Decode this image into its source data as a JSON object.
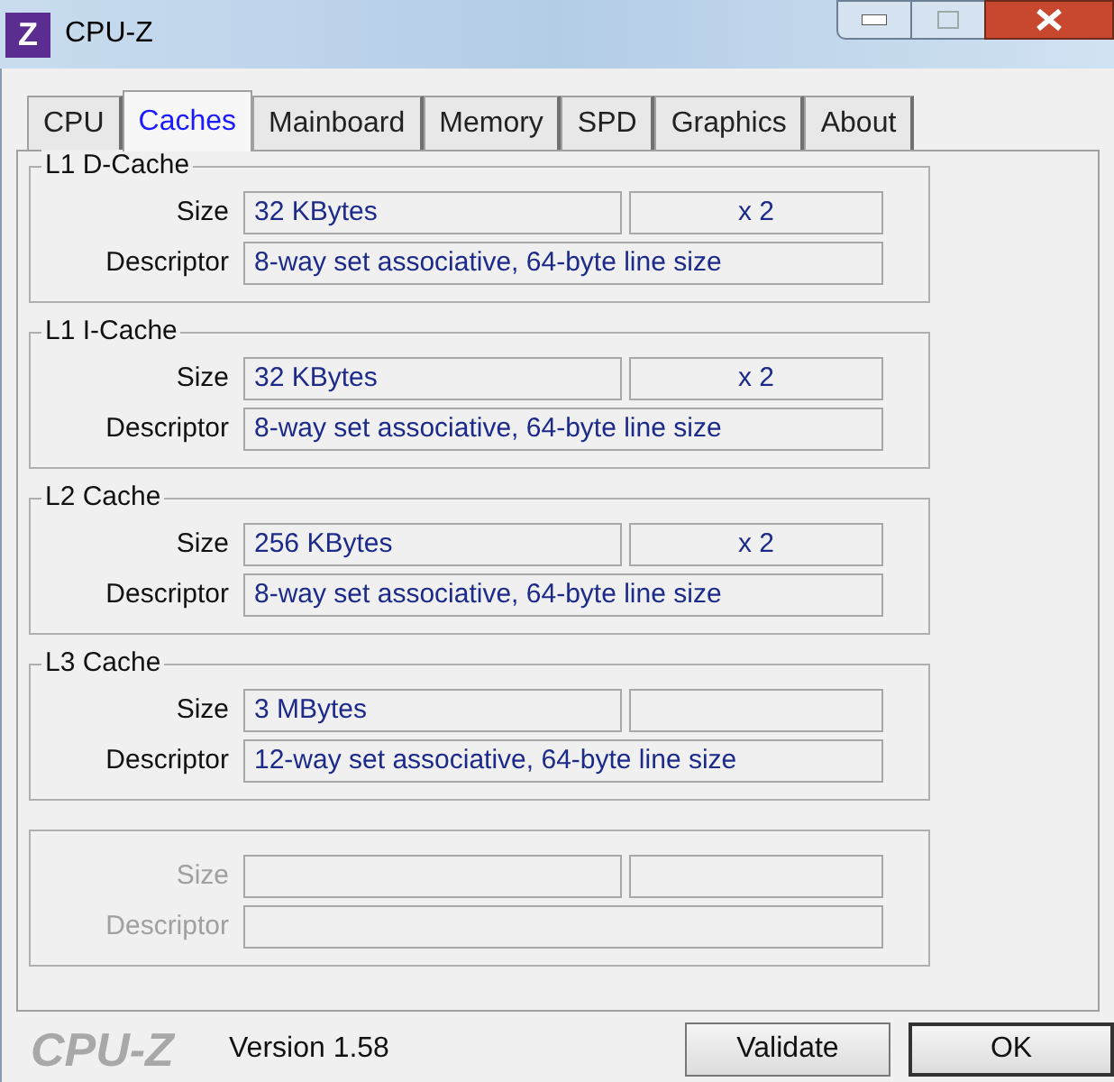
{
  "window": {
    "app_icon": "Z",
    "title": "CPU-Z"
  },
  "tabs": [
    {
      "label": "CPU",
      "selected": false
    },
    {
      "label": "Caches",
      "selected": true
    },
    {
      "label": "Mainboard",
      "selected": false
    },
    {
      "label": "Memory",
      "selected": false
    },
    {
      "label": "SPD",
      "selected": false
    },
    {
      "label": "Graphics",
      "selected": false
    },
    {
      "label": "About",
      "selected": false
    }
  ],
  "groups": [
    {
      "title": "L1 D-Cache",
      "disabled": false,
      "size_label": "Size",
      "size": "32 KBytes",
      "count": "x 2",
      "descriptor_label": "Descriptor",
      "descriptor": "8-way set associative, 64-byte line size"
    },
    {
      "title": "L1 I-Cache",
      "disabled": false,
      "size_label": "Size",
      "size": "32 KBytes",
      "count": "x 2",
      "descriptor_label": "Descriptor",
      "descriptor": "8-way set associative, 64-byte line size"
    },
    {
      "title": "L2 Cache",
      "disabled": false,
      "size_label": "Size",
      "size": "256 KBytes",
      "count": "x 2",
      "descriptor_label": "Descriptor",
      "descriptor": "8-way set associative, 64-byte line size"
    },
    {
      "title": "L3 Cache",
      "disabled": false,
      "size_label": "Size",
      "size": "3 MBytes",
      "descriptor_label": "Descriptor",
      "descriptor": "12-way set associative, 64-byte line size"
    },
    {
      "disabled": true,
      "size_label": "Size",
      "descriptor_label": "Descriptor"
    }
  ],
  "footer": {
    "logo": "CPU-Z",
    "version": "Version 1.58",
    "buttons": [
      "Validate",
      "OK"
    ]
  }
}
